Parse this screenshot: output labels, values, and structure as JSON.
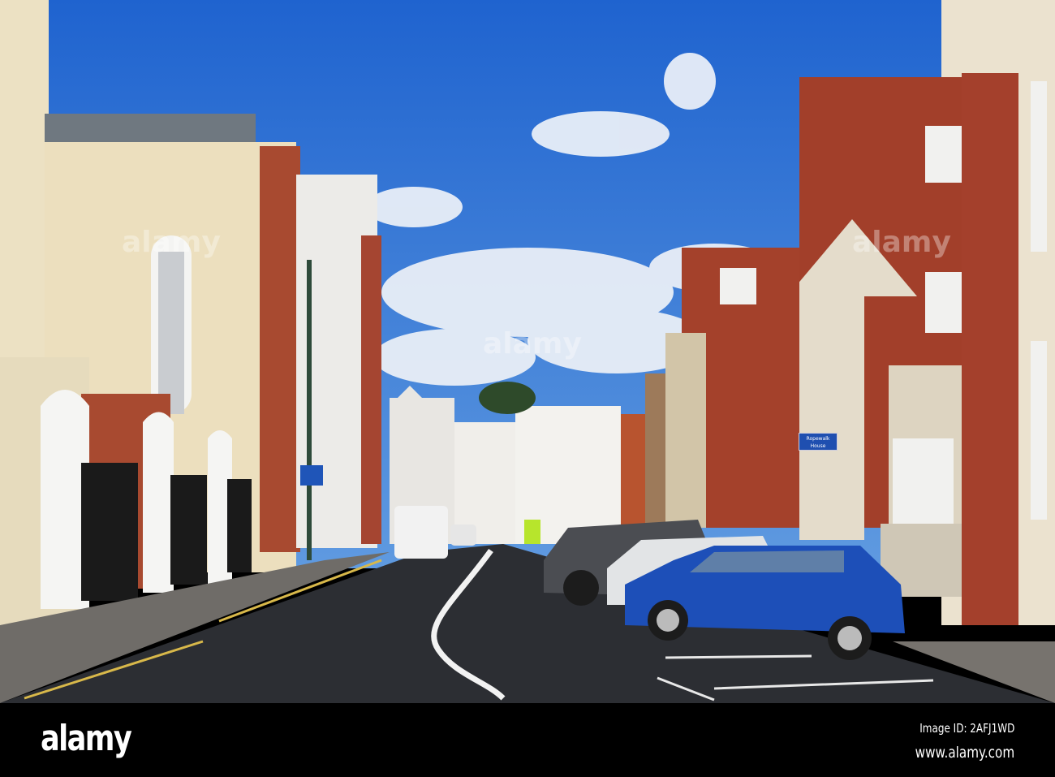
{
  "watermark": {
    "brand": "alamy",
    "image_id": "Image ID: 2AFJ1WD",
    "url": "www.alamy.com"
  },
  "scene": {
    "building_sign_line1": "Ropewalk",
    "building_sign_line2": "House"
  },
  "colors": {
    "sky": "#2f6fd0",
    "brick": "#a5432e",
    "cream": "#e9dfc4",
    "road": "#2c2e33",
    "car_blue": "#1d4fb8"
  }
}
